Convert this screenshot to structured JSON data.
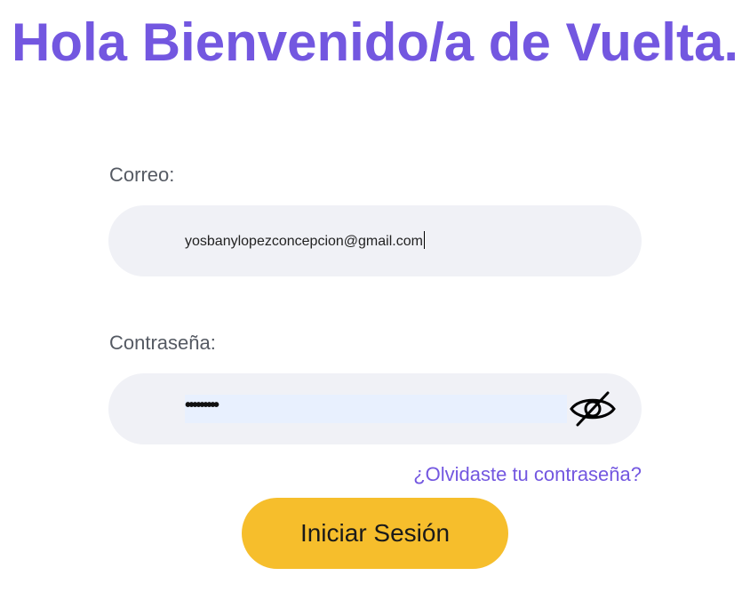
{
  "header": {
    "title": "Hola Bienvenido/a de Vuelta."
  },
  "form": {
    "email_label": "Correo:",
    "email_value": "yosbanylopezconcepcion@gmail.com",
    "password_label": "Contraseña:",
    "password_masked": "•••••••••",
    "toggle_visibility_icon": "eye-slash-icon",
    "forgot_link": "¿Olvidaste tu contraseña?",
    "submit_label": "Iniciar Sesión"
  },
  "colors": {
    "brand_purple": "#7357e0",
    "button_yellow": "#f6be2c",
    "field_bg": "#f0f1f6",
    "autofill_bg": "#e8f0fe"
  }
}
